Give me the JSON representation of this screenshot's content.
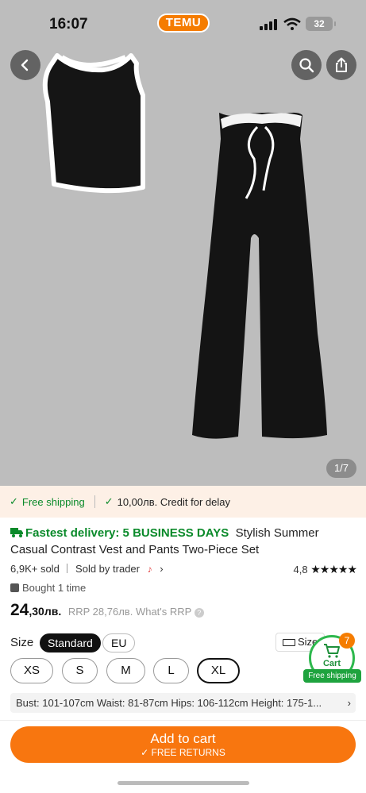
{
  "status_bar": {
    "time": "16:07",
    "brand": "TEMU",
    "battery": "32"
  },
  "gallery": {
    "counter": "1/7"
  },
  "icons": [
    "back-icon",
    "search-icon",
    "share-icon",
    "cart-icon",
    "check-icon",
    "truck-icon",
    "ruler-icon",
    "bag-icon",
    "chevron-right-icon",
    "question-icon"
  ],
  "shipping_strip": {
    "free_shipping": "Free shipping",
    "credit": "10,00лв. Credit for delay"
  },
  "product": {
    "fast_delivery": "Fastest delivery: 5 BUSINESS DAYS",
    "title": "Stylish Summer Casual Contrast Vest and Pants Two-Piece Set",
    "sold": "6,9K+ sold",
    "seller": "Sold by trader",
    "rating": "4,8",
    "stars": "★★★★★",
    "bought": "Bought 1 time",
    "price_whole": "24",
    "price_cents": ",30лв.",
    "rrp": "RRP 28,76лв.",
    "whats_rrp": "What's RRP"
  },
  "size": {
    "label": "Size",
    "standard": "Standard",
    "eu": "EU",
    "guide": "Size",
    "options": [
      "XS",
      "S",
      "M",
      "L",
      "XL"
    ],
    "selected": "XL",
    "measurements": "Bust: 101-107cm  Waist: 81-87cm  Hips: 106-112cm  Height: 175-1..."
  },
  "cart": {
    "count": "7",
    "label": "Cart",
    "free_shipping": "Free shipping"
  },
  "cta": {
    "add_to_cart": "Add to cart",
    "free_returns": "FREE RETURNS"
  },
  "colors": {
    "accent": "#f8760f",
    "green": "#0a8a2a",
    "hero_bg": "#bdbdbd"
  }
}
